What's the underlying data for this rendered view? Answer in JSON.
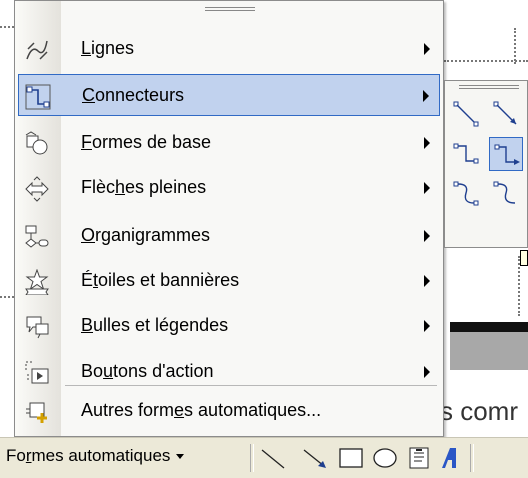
{
  "menu": {
    "items": [
      {
        "key": "lignes",
        "label": "Lignes",
        "mnemonic_index": 0,
        "has_submenu": true,
        "active": false,
        "icon": "lines-icon"
      },
      {
        "key": "connecteurs",
        "label": "Connecteurs",
        "mnemonic_index": 0,
        "has_submenu": true,
        "active": true,
        "icon": "connectors-icon"
      },
      {
        "key": "formes-de-base",
        "label": "Formes de base",
        "mnemonic_index": 0,
        "has_submenu": true,
        "active": false,
        "icon": "basic-shapes-icon"
      },
      {
        "key": "fleches-pleines",
        "label": "Flèches pleines",
        "mnemonic_index": 4,
        "has_submenu": true,
        "active": false,
        "icon": "block-arrows-icon"
      },
      {
        "key": "organigrammes",
        "label": "Organigrammes",
        "mnemonic_index": 0,
        "has_submenu": true,
        "active": false,
        "icon": "flowchart-icon"
      },
      {
        "key": "etoiles",
        "label": "Étoiles et bannières",
        "mnemonic_index": 1,
        "has_submenu": true,
        "active": false,
        "icon": "stars-banners-icon"
      },
      {
        "key": "bulles",
        "label": "Bulles et légendes",
        "mnemonic_index": 0,
        "has_submenu": true,
        "active": false,
        "icon": "callouts-icon"
      },
      {
        "key": "boutons-action",
        "label": "Boutons d'action",
        "mnemonic_index": 2,
        "has_submenu": true,
        "active": false,
        "icon": "action-buttons-icon"
      },
      {
        "key": "autres",
        "label": "Autres formes automatiques...",
        "mnemonic_index": 11,
        "has_submenu": false,
        "active": false,
        "icon": "more-autoshapes-icon"
      }
    ]
  },
  "toolbar": {
    "autoshapes_label": "Formes automatiques",
    "autoshapes_mnemonic_index": 2,
    "tools": [
      "line-icon",
      "arrow-icon",
      "rectangle-icon",
      "oval-icon",
      "text-box-icon",
      "wordart-icon"
    ]
  },
  "document": {
    "visible_text": "s comr"
  },
  "colors": {
    "highlight_fill": "#c1d2ee",
    "highlight_border": "#316ac5",
    "toolbar_bg": "#ece9d8",
    "menu_bg": "#f8f8f6"
  }
}
